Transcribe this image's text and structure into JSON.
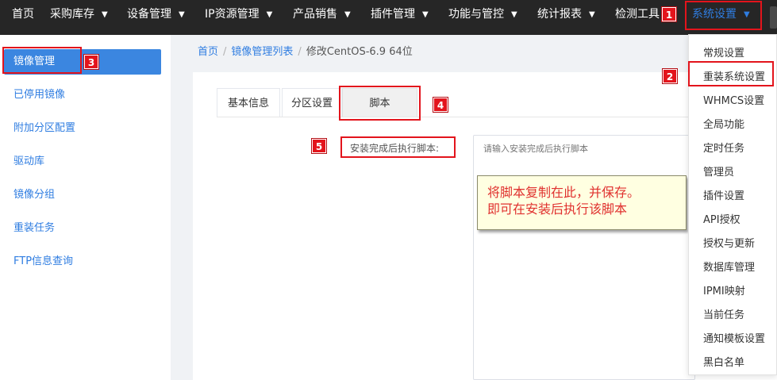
{
  "topnav": {
    "items": [
      {
        "label": "首页"
      },
      {
        "label": "采购库存"
      },
      {
        "label": "设备管理"
      },
      {
        "label": "IP资源管理"
      },
      {
        "label": "产品销售"
      },
      {
        "label": "插件管理"
      },
      {
        "label": "功能与管控"
      },
      {
        "label": "统计报表"
      },
      {
        "label": "检测工具"
      },
      {
        "label": "系统设置"
      }
    ]
  },
  "sidebar": {
    "items": [
      {
        "label": "镜像管理"
      },
      {
        "label": "已停用镜像"
      },
      {
        "label": "附加分区配置"
      },
      {
        "label": "驱动库"
      },
      {
        "label": "镜像分组"
      },
      {
        "label": "重装任务"
      },
      {
        "label": "FTP信息查询"
      }
    ]
  },
  "breadcrumb": {
    "home": "首页",
    "list": "镜像管理列表",
    "current": "修改CentOS-6.9 64位"
  },
  "tabs": [
    {
      "label": "基本信息"
    },
    {
      "label": "分区设置"
    },
    {
      "label": "脚本"
    }
  ],
  "form": {
    "script_label": "安装完成后执行脚本:",
    "script_placeholder": "请输入安装完成后执行脚本"
  },
  "note": {
    "line1": "将脚本复制在此，并保存。",
    "line2": "即可在安装后执行该脚本"
  },
  "dropdown": {
    "items": [
      {
        "label": "常规设置"
      },
      {
        "label": "重装系统设置"
      },
      {
        "label": "WHMCS设置"
      },
      {
        "label": "全局功能"
      },
      {
        "label": "定时任务"
      },
      {
        "label": "管理员"
      },
      {
        "label": "插件设置"
      },
      {
        "label": "API授权"
      },
      {
        "label": "授权与更新"
      },
      {
        "label": "数据库管理"
      },
      {
        "label": "IPMI映射"
      },
      {
        "label": "当前任务"
      },
      {
        "label": "通知模板设置"
      },
      {
        "label": "黑白名单"
      }
    ]
  },
  "annotations": {
    "b1": "1",
    "b2": "2",
    "b3": "3",
    "b4": "4",
    "b5": "5"
  },
  "icons": {
    "chevron": "chevron-down-icon"
  },
  "colors": {
    "accent": "#2f7de1",
    "active_sidebar_bg": "#3b86e0",
    "topbar_bg": "#262626",
    "annotation_red": "#e3141c",
    "note_bg": "#ffffe1",
    "note_text": "#e0312f"
  }
}
